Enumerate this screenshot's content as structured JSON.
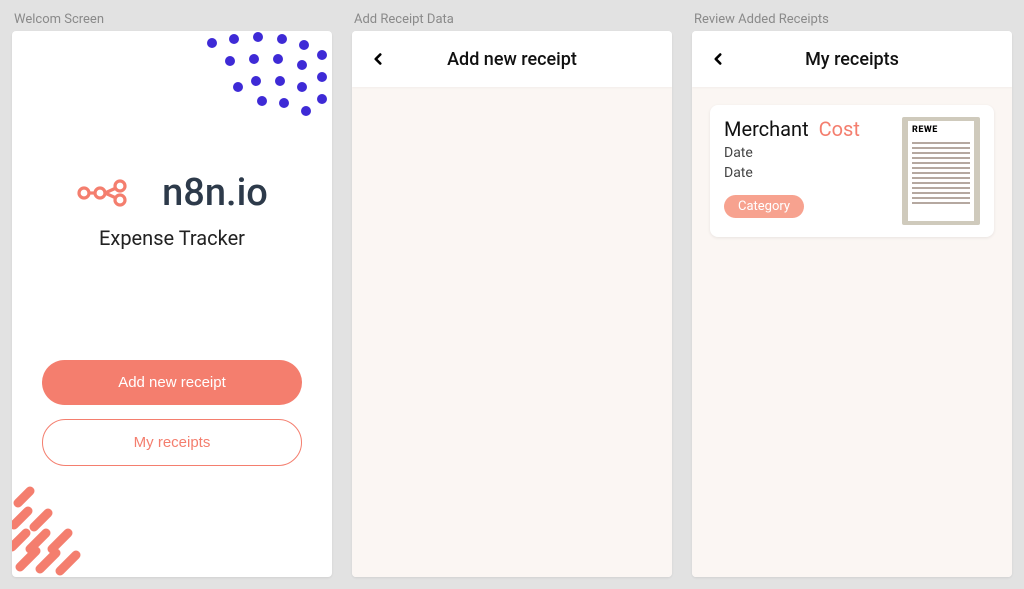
{
  "colors": {
    "accent": "#f47e6e",
    "dots": "#3e2ad6"
  },
  "screens": {
    "welcome": {
      "label": "Welcom Screen",
      "logo_text": "n8n.io",
      "app_title": "Expense Tracker",
      "add_button": "Add new receipt",
      "receipts_button": "My receipts"
    },
    "add": {
      "label": "Add Receipt Data",
      "title": "Add new receipt"
    },
    "review": {
      "label": "Review Added Receipts",
      "title": "My receipts",
      "card": {
        "merchant": "Merchant",
        "cost": "Cost",
        "date1": "Date",
        "date2": "Date",
        "category": "Category",
        "thumb_brand": "REWE"
      }
    }
  }
}
